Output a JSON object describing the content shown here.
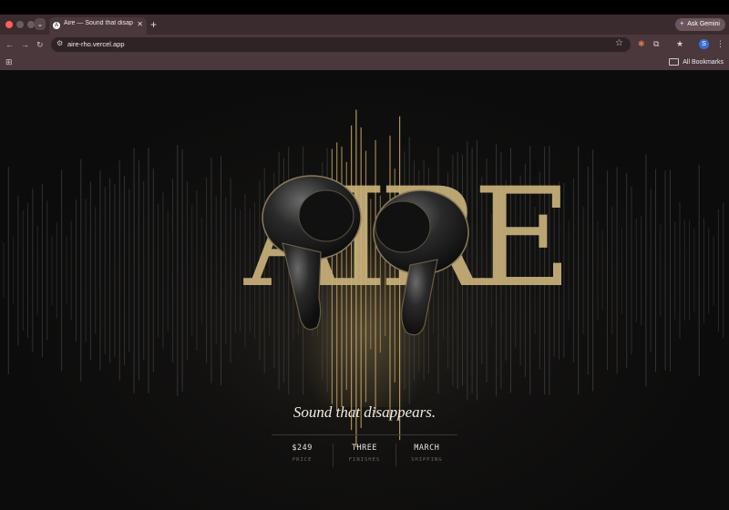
{
  "browser": {
    "tab_title": "Aire — Sound that disappears",
    "tab_favicon": "A",
    "ask_label": "Ask Gemini",
    "url": "aire-rho.vercel.app",
    "profile_initial": "S",
    "bookmarks_label": "All Bookmarks"
  },
  "hero": {
    "wordmark": "AIRE",
    "tagline": "Sound that disappears.",
    "accent_color": "#c9b17a"
  },
  "specs": [
    {
      "value": "$249",
      "label": "PRICE"
    },
    {
      "value": "THREE",
      "label": "FINISHES"
    },
    {
      "value": "MARCH",
      "label": "SHIPPING"
    }
  ]
}
